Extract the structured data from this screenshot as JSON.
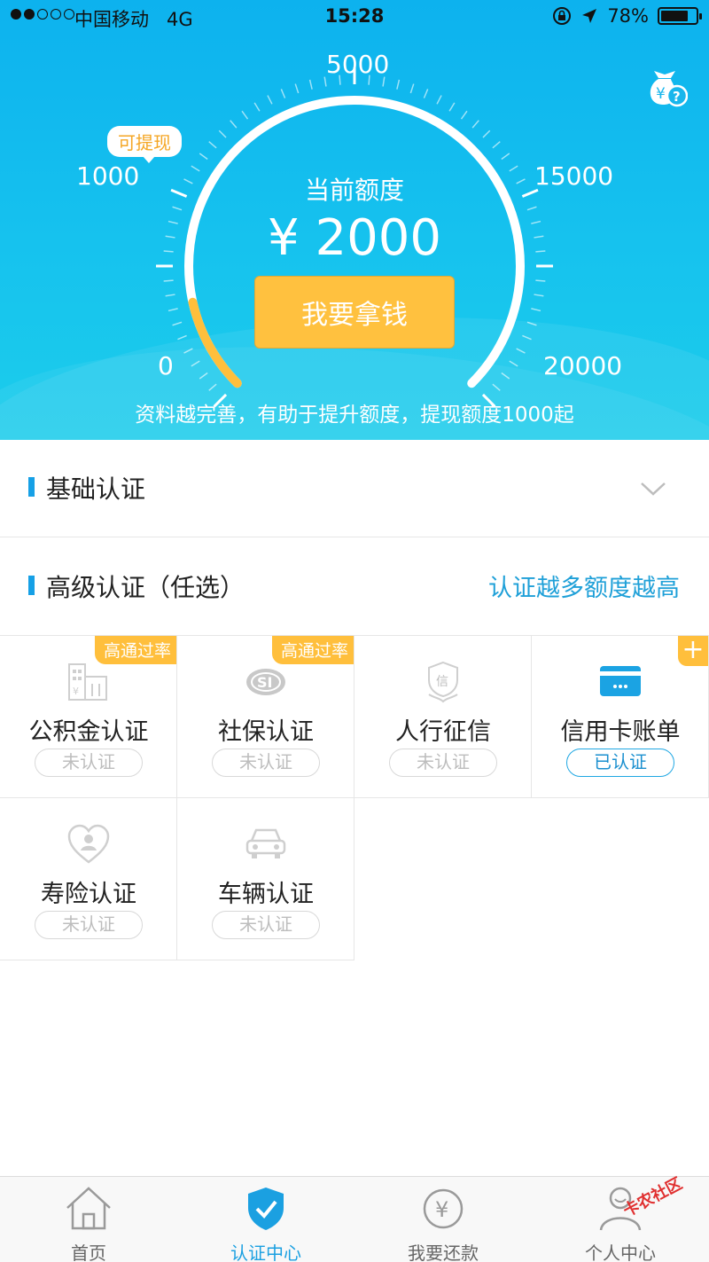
{
  "status_bar": {
    "carrier": "中国移动",
    "network": "4G",
    "time": "15:28",
    "battery_text": "78%",
    "battery_level": 0.78,
    "signal_bars": 2
  },
  "gauge": {
    "scale_labels": {
      "s0": "0",
      "s1000": "1000",
      "s5000": "5000",
      "s15000": "15000",
      "s20000": "20000"
    },
    "withdrawable_tip": "可提现",
    "current_label": "当前额度",
    "current_amount": "¥ 2000",
    "current_value": 2000,
    "max_value": 20000,
    "action_button": "我要拿钱",
    "hint": "资料越完善，有助于提升额度，提现额度1000起",
    "help_icon": "money-bag-help-icon"
  },
  "basic_section": {
    "title": "基础认证",
    "icon": "chevron-down-icon"
  },
  "advanced_section": {
    "title": "高级认证（任选）",
    "more": "认证越多额度越高"
  },
  "cards": [
    {
      "name": "公积金认证",
      "status": "未认证",
      "badge": "高通过率",
      "icon": "building-icon"
    },
    {
      "name": "社保认证",
      "status": "未认证",
      "badge": "高通过率",
      "icon": "social-security-icon"
    },
    {
      "name": "人行征信",
      "status": "未认证",
      "badge": "",
      "icon": "credit-report-icon"
    },
    {
      "name": "信用卡账单",
      "status": "已认证",
      "badge": "+",
      "icon": "credit-card-icon"
    },
    {
      "name": "寿险认证",
      "status": "未认证",
      "badge": "",
      "icon": "life-insurance-icon"
    },
    {
      "name": "车辆认证",
      "status": "未认证",
      "badge": "",
      "icon": "car-icon"
    }
  ],
  "tabs": [
    {
      "label": "首页",
      "icon": "home-icon"
    },
    {
      "label": "认证中心",
      "icon": "shield-check-icon",
      "active": true
    },
    {
      "label": "我要还款",
      "icon": "yuan-circle-icon"
    },
    {
      "label": "个人中心",
      "icon": "person-icon"
    }
  ],
  "watermark": "卡农社区",
  "colors": {
    "primary": "#16a0e6",
    "accent": "#ffc13f",
    "hero": "#12bdee",
    "text": "#222222"
  }
}
